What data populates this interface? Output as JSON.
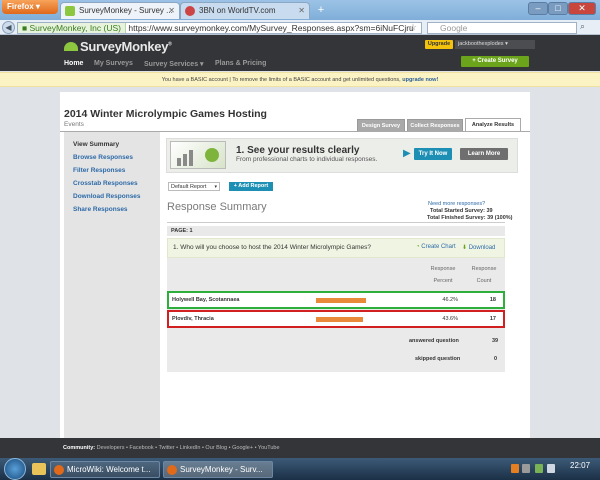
{
  "browser": {
    "menu_label": "Firefox",
    "tabs": [
      {
        "title": "SurveyMonkey - Survey ...",
        "active": true
      },
      {
        "title": "3BN on WorldTV.com",
        "active": false
      }
    ],
    "new_tab": "+",
    "identity": "SurveyMonkey, Inc (US)",
    "url": "https://www.surveymonkey.com/MySurvey_Responses.aspx?sm=6iNuFCjru",
    "search_placeholder": "Google",
    "win_buttons": [
      "–",
      "□",
      "✕"
    ]
  },
  "header": {
    "logo": "SurveyMonkey",
    "logo_reg": "®",
    "nav": [
      "Home",
      "My Surveys",
      "Survey Services ▾",
      "Plans & Pricing"
    ],
    "upgrade": "Upgrade",
    "user": "jackboothexplodes ▾",
    "create": "+ Create Survey"
  },
  "banner": {
    "text": "You have a BASIC account  |  To remove the limits of a BASIC account and get unlimited questions,",
    "link": "upgrade now!"
  },
  "survey": {
    "title": "2014 Winter Microlympic Games Hosting",
    "subtitle": "Events",
    "tabs": [
      "Design Survey",
      "Collect Responses",
      "Analyze Results"
    ]
  },
  "sidebar": [
    "View Summary",
    "Browse Responses",
    "Filter Responses",
    "Crosstab Responses",
    "Download Responses",
    "Share Responses"
  ],
  "promo": {
    "heading": "1. See your results clearly",
    "sub": "From professional charts to individual responses.",
    "try": "Try It Now",
    "learn": "Learn More"
  },
  "report": {
    "select": "Default Report",
    "arrow": "▾",
    "add": "+ Add Report"
  },
  "summary": {
    "title": "Response Summary",
    "need_more": "Need more responses?",
    "started": "Total Started Survey: 39",
    "finished": "Total Finished Survey: 39  (100%)",
    "page": "PAGE: 1"
  },
  "question": {
    "text": "1. Who will you choose to host the 2014 Winter Microlympic Games?",
    "create_chart": "Create Chart",
    "download": "Download",
    "col_percent": [
      "Response",
      "Percent"
    ],
    "col_count": [
      "Response",
      "Count"
    ],
    "rows": [
      {
        "label": "Holywell Bay, Scotannaea",
        "percent": "46.2%",
        "count": "18",
        "fill": 0.462
      },
      {
        "label": "Plovdiv, Thracia",
        "percent": "43.6%",
        "count": "17",
        "fill": 0.436
      }
    ],
    "answered_label": "answered question",
    "answered": "39",
    "skipped_label": "skipped question",
    "skipped": "0"
  },
  "footer": {
    "label": "Community:",
    "links": "Developers  •  Facebook  •  Twitter  •  LinkedIn  •  Our Blog  •  Google+  •  YouTube"
  },
  "taskbar": {
    "items": [
      "MicroWiki: Welcome t...",
      "SurveyMonkey - Surv..."
    ],
    "time": "22:07"
  },
  "colors": {
    "accent": "#8dc63f",
    "link": "#2d6aa8",
    "bar": "#e9893a",
    "highlight_green": "#2eae3a",
    "highlight_red": "#d21f1f"
  }
}
